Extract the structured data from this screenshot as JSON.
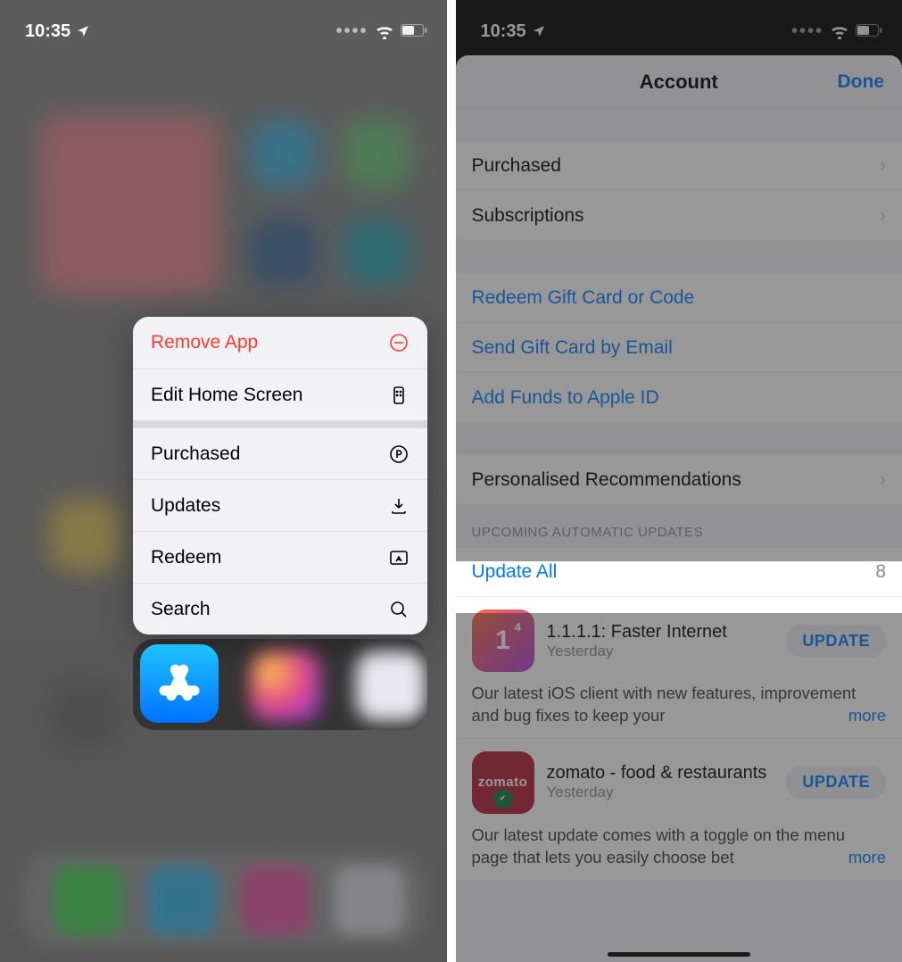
{
  "status": {
    "time": "10:35"
  },
  "left": {
    "context_menu": {
      "remove": "Remove App",
      "edit": "Edit Home Screen",
      "purchased": "Purchased",
      "updates": "Updates",
      "redeem": "Redeem",
      "search": "Search"
    }
  },
  "right": {
    "header": {
      "title": "Account",
      "done": "Done"
    },
    "cells": {
      "purchased": "Purchased",
      "subscriptions": "Subscriptions",
      "redeem": "Redeem Gift Card or Code",
      "send_gift": "Send Gift Card by Email",
      "add_funds": "Add Funds to Apple ID",
      "recs": "Personalised Recommendations"
    },
    "section_header": "Upcoming Automatic Updates",
    "update_all": {
      "label": "Update All",
      "count": "8"
    },
    "apps": [
      {
        "icon_text": "1",
        "icon_sup": "4",
        "name": "1.1.1.1: Faster Internet",
        "sub": "Yesterday",
        "button": "UPDATE",
        "desc": "Our latest iOS client with new features, improvement and bug fixes to keep your",
        "more": "more"
      },
      {
        "icon_text": "zomato",
        "name": "zomato - food & restaurants",
        "sub": "Yesterday",
        "button": "UPDATE",
        "desc": "Our latest update comes with a toggle on the menu page that lets you easily choose bet",
        "more": "more"
      }
    ]
  }
}
